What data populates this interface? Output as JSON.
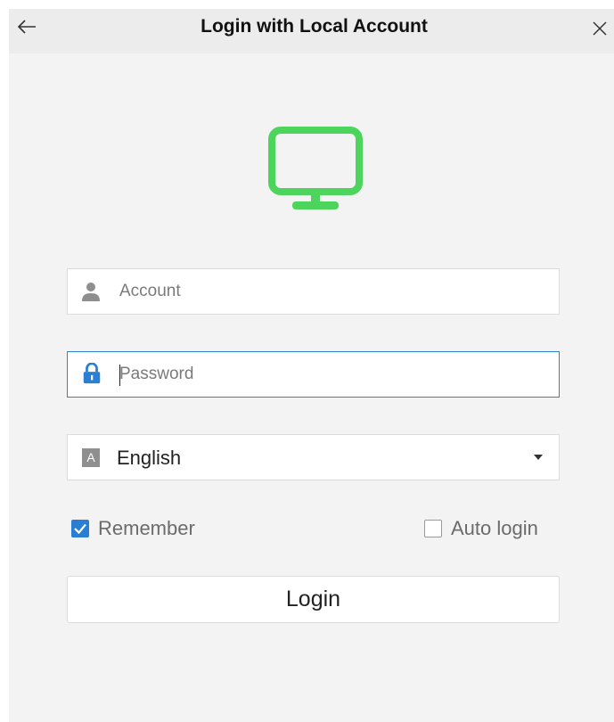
{
  "window": {
    "title": "Login with Local Account"
  },
  "icons": {
    "back": "arrow-left-icon",
    "close": "close-icon",
    "monitor": "monitor-icon",
    "account": "user-icon",
    "password": "lock-icon",
    "dropdown": "chevron-down-icon"
  },
  "form": {
    "account": {
      "placeholder": "Account",
      "value": ""
    },
    "password": {
      "placeholder": "Password",
      "value": ""
    },
    "language": {
      "badge": "A",
      "selected": "English"
    },
    "remember": {
      "label": "Remember",
      "checked": true
    },
    "auto_login": {
      "label": "Auto login",
      "checked": false
    },
    "login_label": "Login"
  },
  "colors": {
    "monitor_icon": "#4cd45c",
    "focus_border": "#2f83d2",
    "checkbox_checked": "#2a7fd4",
    "lock_icon": "#2a7fd4"
  }
}
